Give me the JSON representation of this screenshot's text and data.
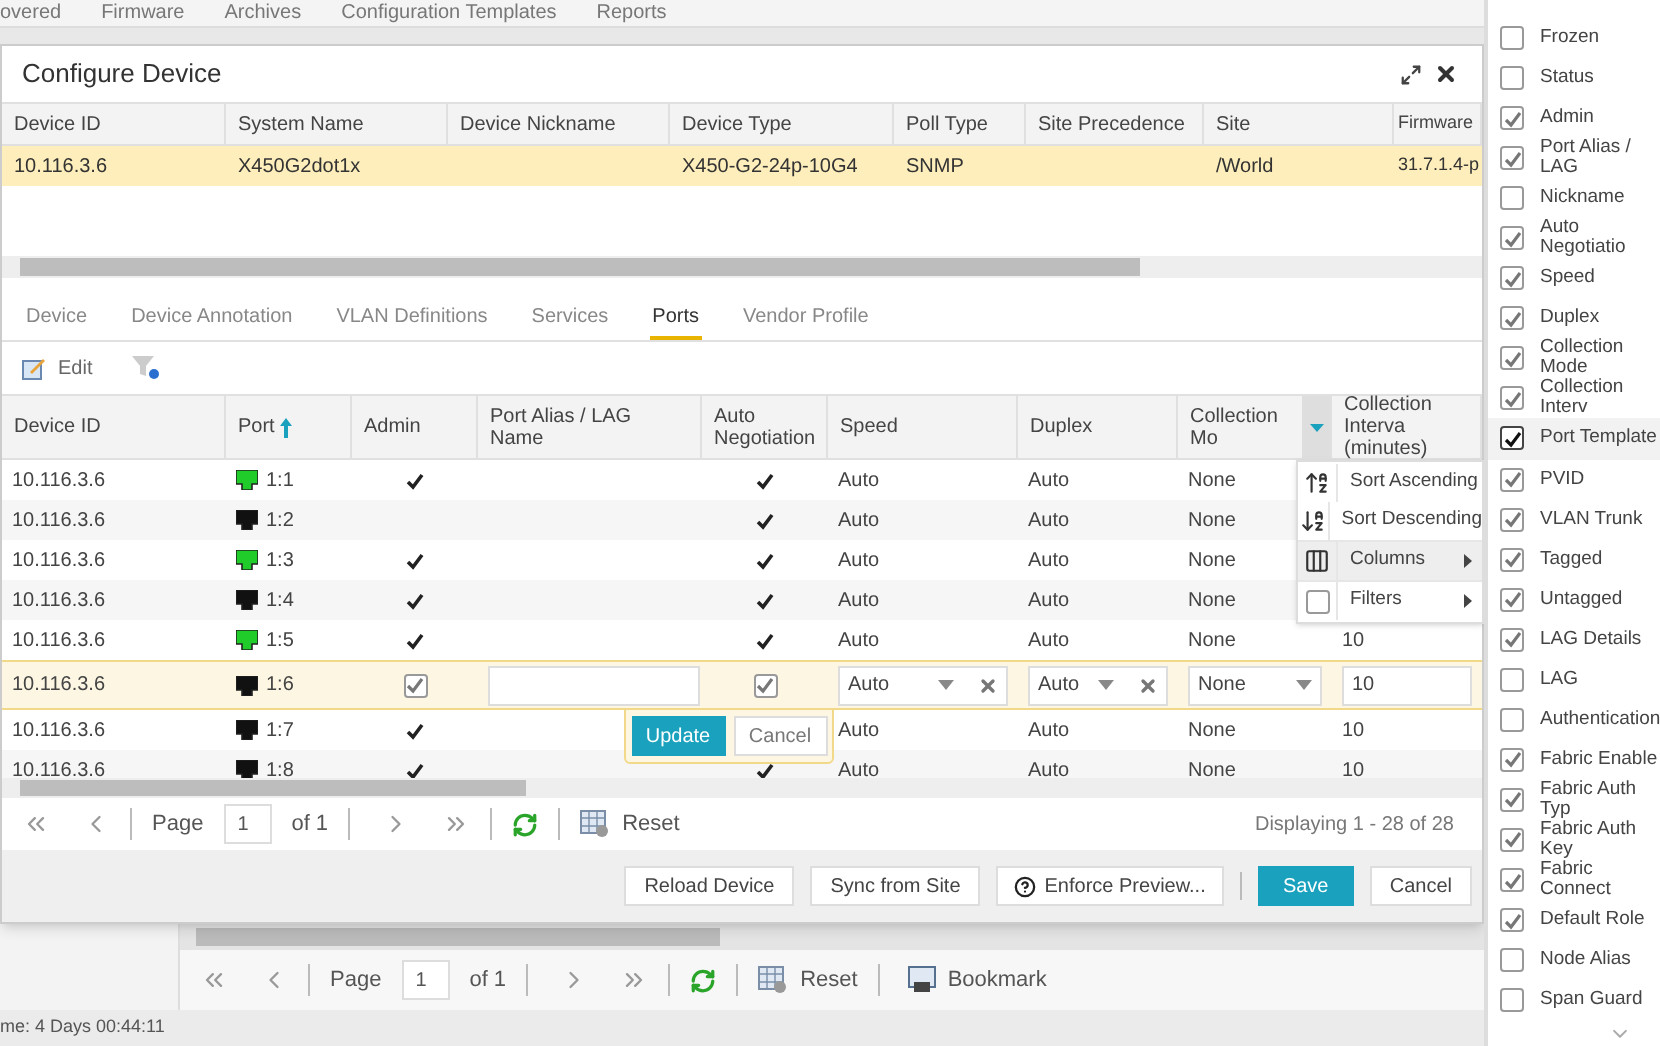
{
  "top_nav": [
    "overed",
    "Firmware",
    "Archives",
    "Configuration Templates",
    "Reports"
  ],
  "dialog": {
    "title": "Configure Device",
    "device_grid": {
      "columns": [
        "Device ID",
        "System Name",
        "Device Nickname",
        "Device Type",
        "Poll Type",
        "Site Precedence",
        "Site",
        "Firmware"
      ],
      "rows": [
        {
          "selected": true,
          "cells": [
            "10.116.3.6",
            "X450G2dot1x",
            null,
            "X450-G2-24p-10G4",
            "SNMP",
            null,
            "/World",
            "31.7.1.4-p"
          ]
        }
      ]
    },
    "tabs": [
      {
        "label": "Device",
        "selected": false
      },
      {
        "label": "Device Annotation",
        "selected": false
      },
      {
        "label": "VLAN Definitions",
        "selected": false
      },
      {
        "label": "Services",
        "selected": false
      },
      {
        "label": "Ports",
        "selected": true
      },
      {
        "label": "Vendor Profile",
        "selected": false
      }
    ],
    "toolbar": {
      "edit": "Edit"
    },
    "ports_grid": {
      "columns": [
        {
          "label": "Device ID",
          "sort_ascending": false,
          "menu_open": false
        },
        {
          "label": "Port",
          "sort_ascending": true,
          "menu_open": false
        },
        {
          "label": "Admin",
          "sort_ascending": false,
          "menu_open": false
        },
        {
          "label": "Port Alias / LAG Name",
          "sort_ascending": false,
          "menu_open": false
        },
        {
          "label": "Auto Negotiation",
          "sort_ascending": false,
          "menu_open": false
        },
        {
          "label": "Speed",
          "sort_ascending": false,
          "menu_open": false
        },
        {
          "label": "Duplex",
          "sort_ascending": false,
          "menu_open": false
        },
        {
          "label": "Collection Mo",
          "sort_ascending": false,
          "menu_open": true
        },
        {
          "label": "Collection Interva (minutes)",
          "sort_ascending": false,
          "menu_open": false
        }
      ],
      "rows": [
        {
          "device_id": "10.116.3.6",
          "port": "1:1",
          "link_up": true,
          "admin": true,
          "auto_negotiation": true,
          "speed": "Auto",
          "duplex": "Auto",
          "collection_mode": "None",
          "editing": false
        },
        {
          "device_id": "10.116.3.6",
          "port": "1:2",
          "link_up": false,
          "admin": false,
          "auto_negotiation": true,
          "speed": "Auto",
          "duplex": "Auto",
          "collection_mode": "None",
          "editing": false
        },
        {
          "device_id": "10.116.3.6",
          "port": "1:3",
          "link_up": true,
          "admin": true,
          "auto_negotiation": true,
          "speed": "Auto",
          "duplex": "Auto",
          "collection_mode": "None",
          "editing": false
        },
        {
          "device_id": "10.116.3.6",
          "port": "1:4",
          "link_up": false,
          "admin": true,
          "auto_negotiation": true,
          "speed": "Auto",
          "duplex": "Auto",
          "collection_mode": "None",
          "editing": false
        },
        {
          "device_id": "10.116.3.6",
          "port": "1:5",
          "link_up": true,
          "admin": true,
          "auto_negotiation": true,
          "speed": "Auto",
          "duplex": "Auto",
          "collection_mode": "None",
          "interval": "10",
          "editing": false
        },
        {
          "device_id": "10.116.3.6",
          "port": "1:6",
          "link_up": false,
          "admin": true,
          "auto_negotiation": true,
          "speed": "Auto",
          "duplex": "Auto",
          "collection_mode": "None",
          "interval": "10",
          "editing": true
        },
        {
          "device_id": "10.116.3.6",
          "port": "1:7",
          "link_up": false,
          "admin": true,
          "speed": "Auto",
          "duplex": "Auto",
          "collection_mode": "None",
          "interval": "10",
          "editing": false
        },
        {
          "device_id": "10.116.3.6",
          "port": "1:8",
          "link_up": false,
          "admin": true,
          "auto_negotiation": true,
          "speed": "Auto",
          "duplex": "Auto",
          "collection_mode": "None",
          "interval": "10",
          "editing": false
        }
      ]
    },
    "editor_actions": [
      "Update",
      "Cancel"
    ],
    "header_menu": [
      {
        "kind": "sort_asc",
        "label": "Sort Ascending",
        "highlighted": false
      },
      {
        "kind": "sort_desc",
        "label": "Sort Descending",
        "highlighted": false
      },
      {
        "kind": "columns",
        "label": "Columns",
        "highlighted": true
      },
      {
        "kind": "filters",
        "label": "Filters",
        "highlighted": false,
        "checked": false
      }
    ],
    "pager": {
      "page_label": "Page",
      "page": "1",
      "of": "of 1",
      "reset": "Reset",
      "display": "Displaying 1 - 28 of 28"
    },
    "buttons": [
      {
        "kind": "plain",
        "label": "Reload Device"
      },
      {
        "kind": "plain",
        "label": "Sync from Site"
      },
      {
        "kind": "help",
        "label": "Enforce Preview..."
      },
      {
        "kind": "primary",
        "label": "Save"
      },
      {
        "kind": "plain",
        "label": "Cancel"
      }
    ]
  },
  "column_list": [
    {
      "label": "Frozen",
      "checked": false,
      "highlighted": false
    },
    {
      "label": "Status",
      "checked": false,
      "highlighted": false
    },
    {
      "label": "Admin",
      "checked": true,
      "highlighted": false
    },
    {
      "label": "Port Alias / LAG",
      "checked": true,
      "highlighted": false
    },
    {
      "label": "Nickname",
      "checked": false,
      "highlighted": false
    },
    {
      "label": "Auto Negotiatio",
      "checked": true,
      "highlighted": false
    },
    {
      "label": "Speed",
      "checked": true,
      "highlighted": false
    },
    {
      "label": "Duplex",
      "checked": true,
      "highlighted": false
    },
    {
      "label": "Collection Mode",
      "checked": true,
      "highlighted": false
    },
    {
      "label": "Collection Interv",
      "checked": true,
      "highlighted": false
    },
    {
      "label": "Port Template",
      "checked": true,
      "highlighted": true
    },
    {
      "label": "PVID",
      "checked": true,
      "highlighted": false
    },
    {
      "label": "VLAN Trunk",
      "checked": true,
      "highlighted": false
    },
    {
      "label": "Tagged",
      "checked": true,
      "highlighted": false
    },
    {
      "label": "Untagged",
      "checked": true,
      "highlighted": false
    },
    {
      "label": "LAG Details",
      "checked": true,
      "highlighted": false
    },
    {
      "label": "LAG",
      "checked": false,
      "highlighted": false
    },
    {
      "label": "Authentication",
      "checked": false,
      "highlighted": false
    },
    {
      "label": "Fabric Enable",
      "checked": true,
      "highlighted": false
    },
    {
      "label": "Fabric Auth Typ",
      "checked": true,
      "highlighted": false
    },
    {
      "label": "Fabric Auth Key",
      "checked": true,
      "highlighted": false
    },
    {
      "label": "Fabric Connect",
      "checked": true,
      "highlighted": false
    },
    {
      "label": "Default Role",
      "checked": true,
      "highlighted": false
    },
    {
      "label": "Node Alias",
      "checked": false,
      "highlighted": false
    },
    {
      "label": "Span Guard",
      "checked": false,
      "highlighted": false
    }
  ],
  "background_pager": {
    "page_label": "Page",
    "page": "1",
    "of": "of 1",
    "reset": "Reset",
    "bookmark": "Bookmark"
  },
  "status_bar": "me: 4 Days 00:44:11"
}
